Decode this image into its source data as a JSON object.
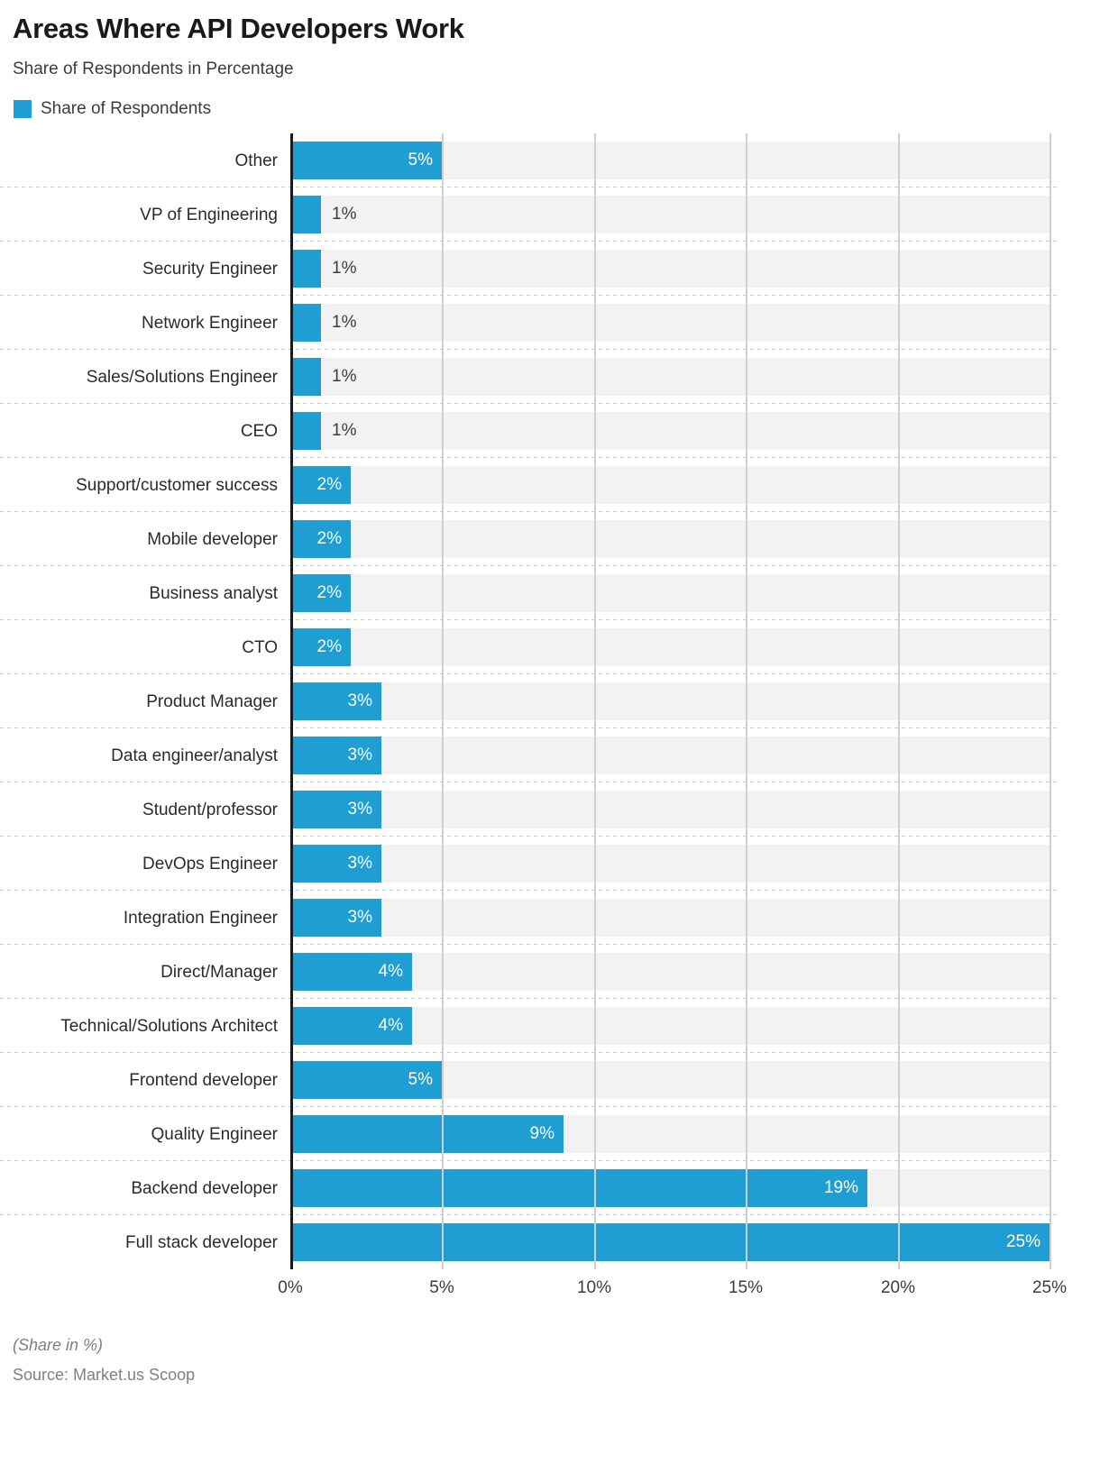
{
  "header": {
    "title": "Areas Where API Developers Work",
    "subtitle": "Share of Respondents in Percentage",
    "legend": {
      "label": "Share of Respondents",
      "color": "#1f9ed4"
    }
  },
  "footer": {
    "note": "(Share in %)",
    "source": "Source: Market.us Scoop"
  },
  "chart_data": {
    "type": "bar",
    "orientation": "horizontal",
    "title": "Areas Where API Developers Work",
    "subtitle": "Share of Respondents in Percentage",
    "xlabel": "",
    "ylabel": "",
    "xlim": [
      0,
      25
    ],
    "xticks": [
      0,
      5,
      10,
      15,
      20,
      25
    ],
    "xtick_labels": [
      "0%",
      "5%",
      "10%",
      "15%",
      "20%",
      "25%"
    ],
    "grid": true,
    "legend_position": "top-left",
    "series_name": "Share of Respondents",
    "color": "#1f9ed4",
    "categories": [
      "Other",
      "VP of Engineering",
      "Security Engineer",
      "Network Engineer",
      "Sales/Solutions Engineer",
      "CEO",
      "Support/customer success",
      "Mobile developer",
      "Business analyst",
      "CTO",
      "Product Manager",
      "Data engineer/analyst",
      "Student/professor",
      "DevOps Engineer",
      "Integration Engineer",
      "Direct/Manager",
      "Technical/Solutions Architect",
      "Frontend developer",
      "Quality Engineer",
      "Backend developer",
      "Full stack developer"
    ],
    "values": [
      5,
      1,
      1,
      1,
      1,
      1,
      2,
      2,
      2,
      2,
      3,
      3,
      3,
      3,
      3,
      4,
      4,
      5,
      9,
      19,
      25
    ],
    "value_labels": [
      "5%",
      "1%",
      "1%",
      "1%",
      "1%",
      "1%",
      "2%",
      "2%",
      "2%",
      "2%",
      "3%",
      "3%",
      "3%",
      "3%",
      "3%",
      "4%",
      "4%",
      "5%",
      "9%",
      "19%",
      "25%"
    ],
    "label_placement": [
      "inside",
      "outside",
      "outside",
      "outside",
      "outside",
      "outside",
      "inside",
      "inside",
      "inside",
      "inside",
      "inside",
      "inside",
      "inside",
      "inside",
      "inside",
      "inside",
      "inside",
      "inside",
      "inside",
      "inside",
      "inside"
    ]
  }
}
